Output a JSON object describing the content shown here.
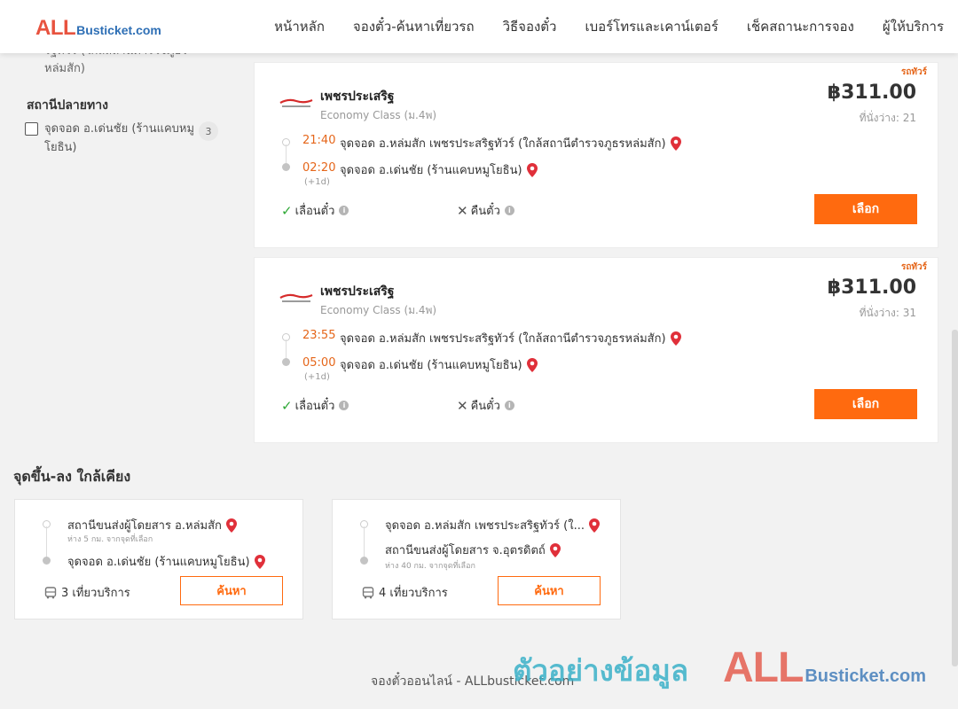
{
  "header": {
    "logo_all": "ALL",
    "logo_rest": "Busticket.com",
    "nav": [
      "หน้าหลัก",
      "จองตั๋ว-ค้นหาเที่ยวรถ",
      "วิธีจองตั๋ว",
      "เบอร์โทรและเคาน์เตอร์",
      "เช็คสถานะการจอง",
      "ผู้ให้บริการ"
    ]
  },
  "sidebar": {
    "cut_text": "รัฐทัวร์ (ใกล้สถานีตำรวจภูธรหล่มสัก)",
    "dest_title": "สถานีปลายทาง",
    "filter": {
      "label": "จุดจอด อ.เด่นชัย (ร้านแคบหมูโยธิน)",
      "count": "3"
    }
  },
  "trips": [
    {
      "badge": "รถทัวร์",
      "operator": "เพชรประเสริฐ",
      "bus_class": "Economy Class (ม.4พ)",
      "price": "฿311.00",
      "seats": "ที่นั่งว่าง: 21",
      "dep_time": "21:40",
      "dep_stop": "จุดจอด อ.หล่มสัก เพชรประสริฐทัวร์ (ใกล้สถานีตำรวจภูธรหล่มสัก)",
      "arr_time": "02:20",
      "arr_stop": "จุดจอด อ.เด่นชัย (ร้านแคบหมูโยธิน)",
      "plus_day": "(+1d)",
      "reschedule": "เลื่อนตั๋ว",
      "refund": "คืนตั๋ว",
      "select": "เลือก"
    },
    {
      "badge": "รถทัวร์",
      "operator": "เพชรประเสริฐ",
      "bus_class": "Economy Class (ม.4พ)",
      "price": "฿311.00",
      "seats": "ที่นั่งว่าง: 31",
      "dep_time": "23:55",
      "dep_stop": "จุดจอด อ.หล่มสัก เพชรประสริฐทัวร์ (ใกล้สถานีตำรวจภูธรหล่มสัก)",
      "arr_time": "05:00",
      "arr_stop": "จุดจอด อ.เด่นชัย (ร้านแคบหมูโยธิน)",
      "plus_day": "(+1d)",
      "reschedule": "เลื่อนตั๋ว",
      "refund": "คืนตั๋ว",
      "select": "เลือก"
    }
  ],
  "nearby": {
    "title": "จุดขึ้น-ลง ใกล้เคียง",
    "cards": [
      {
        "from": "สถานีขนส่งผู้โดยสาร อ.หล่มสัก",
        "from_dist": "ห่าง 5 กม. จากจุดที่เลือก",
        "to": "จุดจอด อ.เด่นชัย (ร้านแคบหมูโยธิน)",
        "to_dist": "",
        "trips": "3 เที่ยวบริการ",
        "search": "ค้นหา"
      },
      {
        "from": "จุดจอด อ.หล่มสัก เพชรประสริฐทัวร์ (ใ...",
        "from_dist": "",
        "to": "สถานีขนส่งผู้โดยสาร จ.อุตรดิตถ์",
        "to_dist": "ห่าง 40 กม. จากจุดที่เลือก",
        "trips": "4 เที่ยวบริการ",
        "search": "ค้นหา"
      }
    ]
  },
  "footer": {
    "text": "จองตั๋วออนไลน์ - ALLbusticket.com",
    "watermark_text": "ตัวอย่างข้อมูล",
    "watermark_all": "ALL",
    "watermark_rest": "Busticket.com"
  },
  "colors": {
    "accent": "#ff6a0f",
    "time": "#e5661a",
    "pin": "#e0303a",
    "check": "#2ea836"
  }
}
